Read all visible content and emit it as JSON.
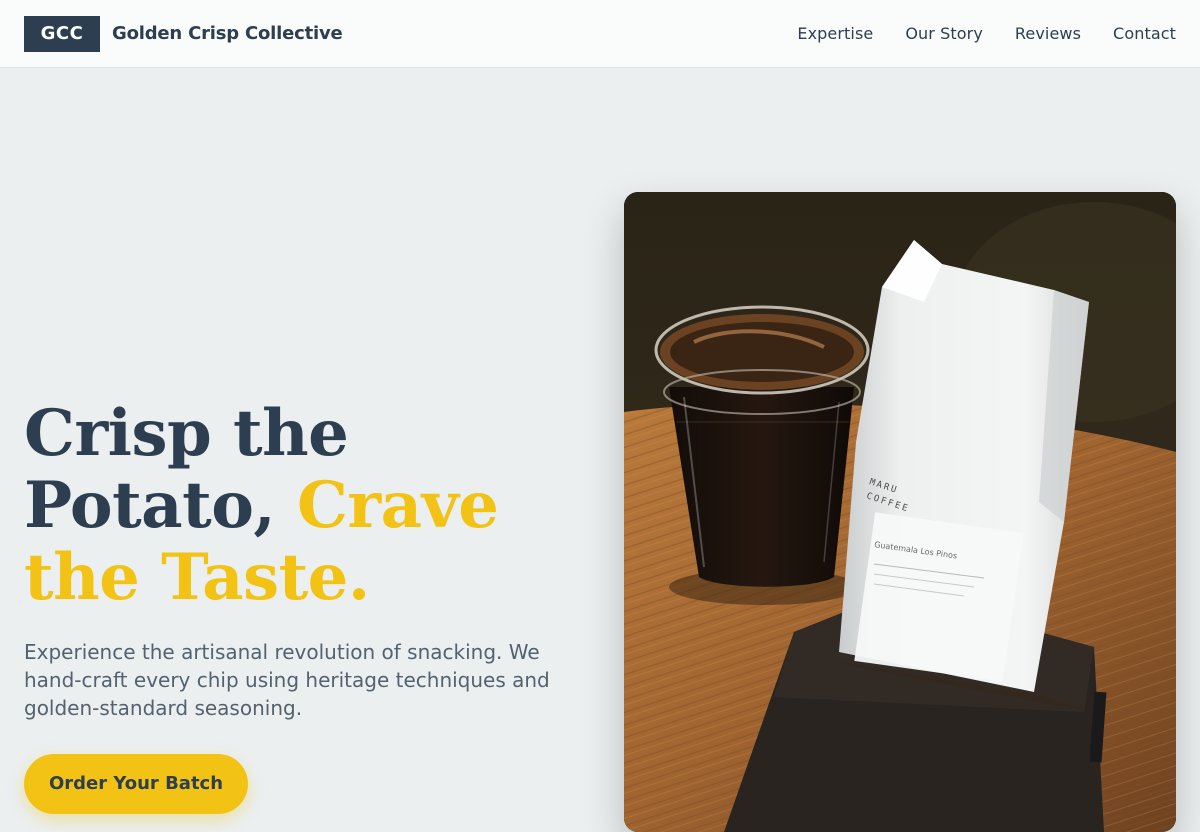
{
  "header": {
    "logo_text": "GCC",
    "brand_name": "Golden Crisp Collective",
    "nav": [
      {
        "label": "Expertise"
      },
      {
        "label": "Our Story"
      },
      {
        "label": "Reviews"
      },
      {
        "label": "Contact"
      }
    ]
  },
  "hero": {
    "title_part1": "Crisp the Potato, ",
    "title_accent": "Crave the Taste.",
    "subtitle": "Experience the artisanal revolution of snacking. We hand-craft every chip using heritage techniques and golden-standard seasoning.",
    "cta_label": "Order Your Batch",
    "image": {
      "bag_brand": "MARU\nCOFFEE",
      "bag_label_title": "Guatemala Los Pinos"
    }
  },
  "colors": {
    "primary_navy": "#2c3e50",
    "accent_gold": "#f2c315",
    "background": "#ebeff0"
  }
}
